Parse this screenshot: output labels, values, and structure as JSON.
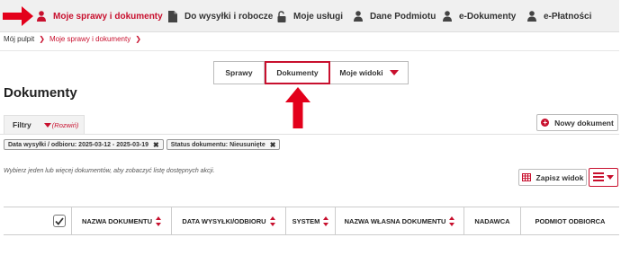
{
  "topnav": {
    "items": [
      {
        "label": "Moje sprawy i dokumenty",
        "icon": "user-icon",
        "active": true
      },
      {
        "label": "Do wysyłki i robocze",
        "icon": "document-icon",
        "active": false
      },
      {
        "label": "Moje usługi",
        "icon": "unlock-icon",
        "active": false
      },
      {
        "label": "Dane Podmiotu",
        "icon": "user-icon",
        "active": false
      },
      {
        "label": "e-Dokumenty",
        "icon": "user-icon",
        "active": false
      },
      {
        "label": "e-Płatności",
        "icon": "user-icon",
        "active": false
      }
    ]
  },
  "breadcrumb": {
    "items": [
      "Mój pulpit",
      "Moje sprawy i dokumenty"
    ]
  },
  "tabs": [
    {
      "label": "Sprawy",
      "active": false
    },
    {
      "label": "Dokumenty",
      "active": true
    },
    {
      "label": "Moje widoki",
      "active": false,
      "dropdown": true
    }
  ],
  "page": {
    "title": "Dokumenty"
  },
  "filters": {
    "tab_label": "Filtry",
    "expand_label": "(Rozwiń)",
    "chips": [
      {
        "label": "Data wysyłki / odbioru: 2025-03-12 - 2025-03-19"
      },
      {
        "label": "Status dokumentu: Nieusunięte"
      }
    ]
  },
  "actions": {
    "new_document": "Nowy dokument",
    "save_view": "Zapisz widok"
  },
  "hint": "Wybierz jeden lub więcej dokumentów, aby zobaczyć listę dostępnych akcji.",
  "table": {
    "columns": [
      {
        "label": "NAZWA DOKUMENTU",
        "sortable": true
      },
      {
        "label": "DATA WYSYŁKI/ODBIORU",
        "sortable": true
      },
      {
        "label": "SYSTEM",
        "sortable": true
      },
      {
        "label": "NAZWA WŁASNA DOKUMENTU",
        "sortable": true
      },
      {
        "label": "NADAWCA",
        "sortable": false
      },
      {
        "label": "PODMIOT ODBIORCA",
        "sortable": false
      }
    ]
  },
  "colors": {
    "accent": "#c8102e",
    "nav_bg": "#f0f0f0",
    "text": "#222222"
  }
}
